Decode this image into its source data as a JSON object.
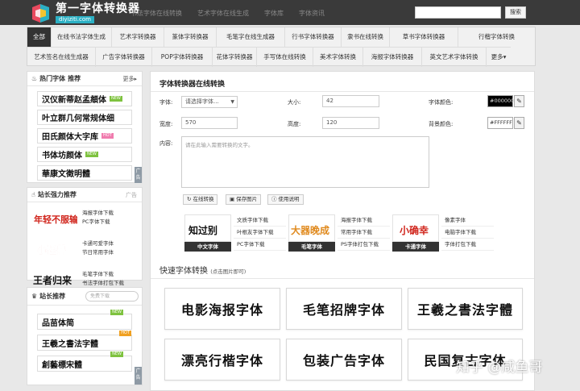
{
  "header": {
    "site_title": "第一字体转换器",
    "site_url": "diyiziti.com",
    "nav": [
      "书法字体在线转换",
      "艺术字体在线生成",
      "字体库",
      "字体资讯"
    ],
    "search_button": "搜索",
    "brand_color": "#2bb0c4"
  },
  "categories": {
    "row1": [
      "全部",
      "在线书法字体生成",
      "艺术字转换器",
      "篆体字转换器",
      "毛笔字在线生成器",
      "行书字体转换器",
      "隶书在线转换",
      "草书字体转换器",
      "行楷字体转换"
    ],
    "row2": [
      "艺术签名在线生成器",
      "广告字体转换器",
      "POP字体转换器",
      "花体字转换器",
      "手写体在线转换",
      "美术字体转换",
      "海报字体转换器",
      "英文艺术字体转换",
      "更多▾"
    ]
  },
  "hot_fonts": {
    "title": "热门字体",
    "subtitle": "推荐",
    "more": "更多▸",
    "items": [
      {
        "text": "汉仪新蒂赵孟頫体",
        "badge": "NEW",
        "badge_color": "#7ec23f"
      },
      {
        "text": "叶立群几何常规体细",
        "badge": "",
        "badge_color": ""
      },
      {
        "text": "田氏颜体大字库",
        "badge": "HOT",
        "badge_color": "#f07cae"
      },
      {
        "text": "书体坊颜体",
        "badge": "NEW",
        "badge_color": "#7ec23f"
      },
      {
        "text": "華康文徵明體",
        "badge": "",
        "badge_color": ""
      }
    ],
    "side_tag": "广告"
  },
  "recommend": {
    "title": "站长强力推荐",
    "tag": "广告",
    "rows": [
      {
        "img_text": "年轻不服输",
        "links": [
          "海报字体下载",
          "PC字体下载"
        ]
      },
      {
        "img_text": "小怪兽",
        "links": [
          "卡通可爱字体",
          "节日常用字体"
        ]
      },
      {
        "img_text": "王者归来",
        "links": [
          "毛笔字体下载",
          "书法字体打包下载"
        ]
      }
    ]
  },
  "owner_recommend": {
    "title": "站长推荐",
    "search_placeholder": "免费下载",
    "items": [
      {
        "text": "品苗体简",
        "badge": "NEW",
        "badge_color": "#7ec23f"
      },
      {
        "text": "王羲之書法字體",
        "badge": "HOT",
        "badge_color": "#f0a020"
      },
      {
        "text": "創藝標宋體",
        "badge": "NEW",
        "badge_color": "#7ec23f"
      }
    ],
    "side_tag": "广告"
  },
  "converter": {
    "title": "字体转换器在线转换",
    "font_label": "字体:",
    "font_select": "请选择字体...",
    "size_label": "大小:",
    "size_value": "42",
    "color_label": "字体颜色:",
    "color_value": "#000000",
    "width_label": "宽度:",
    "width_value": "570",
    "height_label": "高度:",
    "height_value": "120",
    "bg_label": "背景颜色:",
    "bg_value": "#FFFFFF",
    "content_label": "内容:",
    "content_placeholder": "请在此输入需要转换的文字。",
    "btn_convert": "在线转换",
    "btn_save": "保存图片",
    "btn_help": "使用说明"
  },
  "promo_cards": [
    {
      "label": "中文字体",
      "img_text": "知过别",
      "links": [
        "文质字体下载",
        "叶根友字体下载",
        "PC字体下载"
      ]
    },
    {
      "label": "毛笔字体",
      "img_text": "大器晚成",
      "links": [
        "海报字体下载",
        "常用字体下载",
        "PS字体打包下载"
      ]
    },
    {
      "label": "卡通字体",
      "img_text": "小确幸",
      "links": [
        "像素字体",
        "电脑字体下载",
        "字体打包下载"
      ]
    }
  ],
  "quick": {
    "title": "快速字体转换",
    "hint": "(点击图片即可)",
    "items": [
      "电影海报字体",
      "毛笔招牌字体",
      "王羲之書法字體",
      "漂亮行楷字体",
      "包装广告字体",
      "民国复古字体"
    ]
  },
  "watermark": "知乎 @咸鱼哥"
}
